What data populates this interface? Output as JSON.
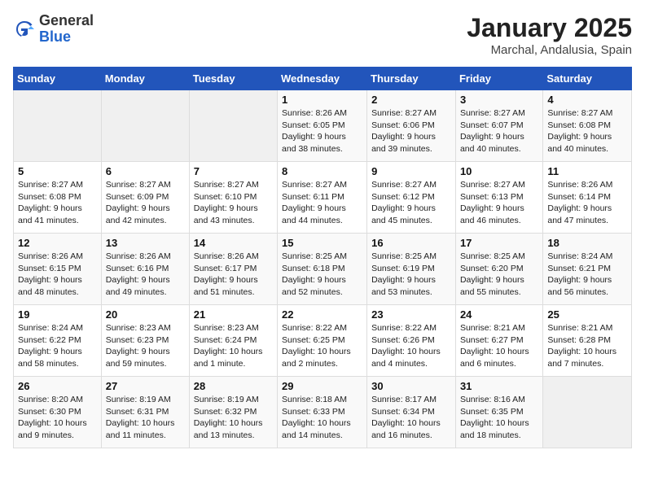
{
  "header": {
    "logo_general": "General",
    "logo_blue": "Blue",
    "month_year": "January 2025",
    "location": "Marchal, Andalusia, Spain"
  },
  "weekdays": [
    "Sunday",
    "Monday",
    "Tuesday",
    "Wednesday",
    "Thursday",
    "Friday",
    "Saturday"
  ],
  "weeks": [
    [
      {
        "day": "",
        "info": ""
      },
      {
        "day": "",
        "info": ""
      },
      {
        "day": "",
        "info": ""
      },
      {
        "day": "1",
        "info": "Sunrise: 8:26 AM\nSunset: 6:05 PM\nDaylight: 9 hours and 38 minutes."
      },
      {
        "day": "2",
        "info": "Sunrise: 8:27 AM\nSunset: 6:06 PM\nDaylight: 9 hours and 39 minutes."
      },
      {
        "day": "3",
        "info": "Sunrise: 8:27 AM\nSunset: 6:07 PM\nDaylight: 9 hours and 40 minutes."
      },
      {
        "day": "4",
        "info": "Sunrise: 8:27 AM\nSunset: 6:08 PM\nDaylight: 9 hours and 40 minutes."
      }
    ],
    [
      {
        "day": "5",
        "info": "Sunrise: 8:27 AM\nSunset: 6:08 PM\nDaylight: 9 hours and 41 minutes."
      },
      {
        "day": "6",
        "info": "Sunrise: 8:27 AM\nSunset: 6:09 PM\nDaylight: 9 hours and 42 minutes."
      },
      {
        "day": "7",
        "info": "Sunrise: 8:27 AM\nSunset: 6:10 PM\nDaylight: 9 hours and 43 minutes."
      },
      {
        "day": "8",
        "info": "Sunrise: 8:27 AM\nSunset: 6:11 PM\nDaylight: 9 hours and 44 minutes."
      },
      {
        "day": "9",
        "info": "Sunrise: 8:27 AM\nSunset: 6:12 PM\nDaylight: 9 hours and 45 minutes."
      },
      {
        "day": "10",
        "info": "Sunrise: 8:27 AM\nSunset: 6:13 PM\nDaylight: 9 hours and 46 minutes."
      },
      {
        "day": "11",
        "info": "Sunrise: 8:26 AM\nSunset: 6:14 PM\nDaylight: 9 hours and 47 minutes."
      }
    ],
    [
      {
        "day": "12",
        "info": "Sunrise: 8:26 AM\nSunset: 6:15 PM\nDaylight: 9 hours and 48 minutes."
      },
      {
        "day": "13",
        "info": "Sunrise: 8:26 AM\nSunset: 6:16 PM\nDaylight: 9 hours and 49 minutes."
      },
      {
        "day": "14",
        "info": "Sunrise: 8:26 AM\nSunset: 6:17 PM\nDaylight: 9 hours and 51 minutes."
      },
      {
        "day": "15",
        "info": "Sunrise: 8:25 AM\nSunset: 6:18 PM\nDaylight: 9 hours and 52 minutes."
      },
      {
        "day": "16",
        "info": "Sunrise: 8:25 AM\nSunset: 6:19 PM\nDaylight: 9 hours and 53 minutes."
      },
      {
        "day": "17",
        "info": "Sunrise: 8:25 AM\nSunset: 6:20 PM\nDaylight: 9 hours and 55 minutes."
      },
      {
        "day": "18",
        "info": "Sunrise: 8:24 AM\nSunset: 6:21 PM\nDaylight: 9 hours and 56 minutes."
      }
    ],
    [
      {
        "day": "19",
        "info": "Sunrise: 8:24 AM\nSunset: 6:22 PM\nDaylight: 9 hours and 58 minutes."
      },
      {
        "day": "20",
        "info": "Sunrise: 8:23 AM\nSunset: 6:23 PM\nDaylight: 9 hours and 59 minutes."
      },
      {
        "day": "21",
        "info": "Sunrise: 8:23 AM\nSunset: 6:24 PM\nDaylight: 10 hours and 1 minute."
      },
      {
        "day": "22",
        "info": "Sunrise: 8:22 AM\nSunset: 6:25 PM\nDaylight: 10 hours and 2 minutes."
      },
      {
        "day": "23",
        "info": "Sunrise: 8:22 AM\nSunset: 6:26 PM\nDaylight: 10 hours and 4 minutes."
      },
      {
        "day": "24",
        "info": "Sunrise: 8:21 AM\nSunset: 6:27 PM\nDaylight: 10 hours and 6 minutes."
      },
      {
        "day": "25",
        "info": "Sunrise: 8:21 AM\nSunset: 6:28 PM\nDaylight: 10 hours and 7 minutes."
      }
    ],
    [
      {
        "day": "26",
        "info": "Sunrise: 8:20 AM\nSunset: 6:30 PM\nDaylight: 10 hours and 9 minutes."
      },
      {
        "day": "27",
        "info": "Sunrise: 8:19 AM\nSunset: 6:31 PM\nDaylight: 10 hours and 11 minutes."
      },
      {
        "day": "28",
        "info": "Sunrise: 8:19 AM\nSunset: 6:32 PM\nDaylight: 10 hours and 13 minutes."
      },
      {
        "day": "29",
        "info": "Sunrise: 8:18 AM\nSunset: 6:33 PM\nDaylight: 10 hours and 14 minutes."
      },
      {
        "day": "30",
        "info": "Sunrise: 8:17 AM\nSunset: 6:34 PM\nDaylight: 10 hours and 16 minutes."
      },
      {
        "day": "31",
        "info": "Sunrise: 8:16 AM\nSunset: 6:35 PM\nDaylight: 10 hours and 18 minutes."
      },
      {
        "day": "",
        "info": ""
      }
    ]
  ]
}
